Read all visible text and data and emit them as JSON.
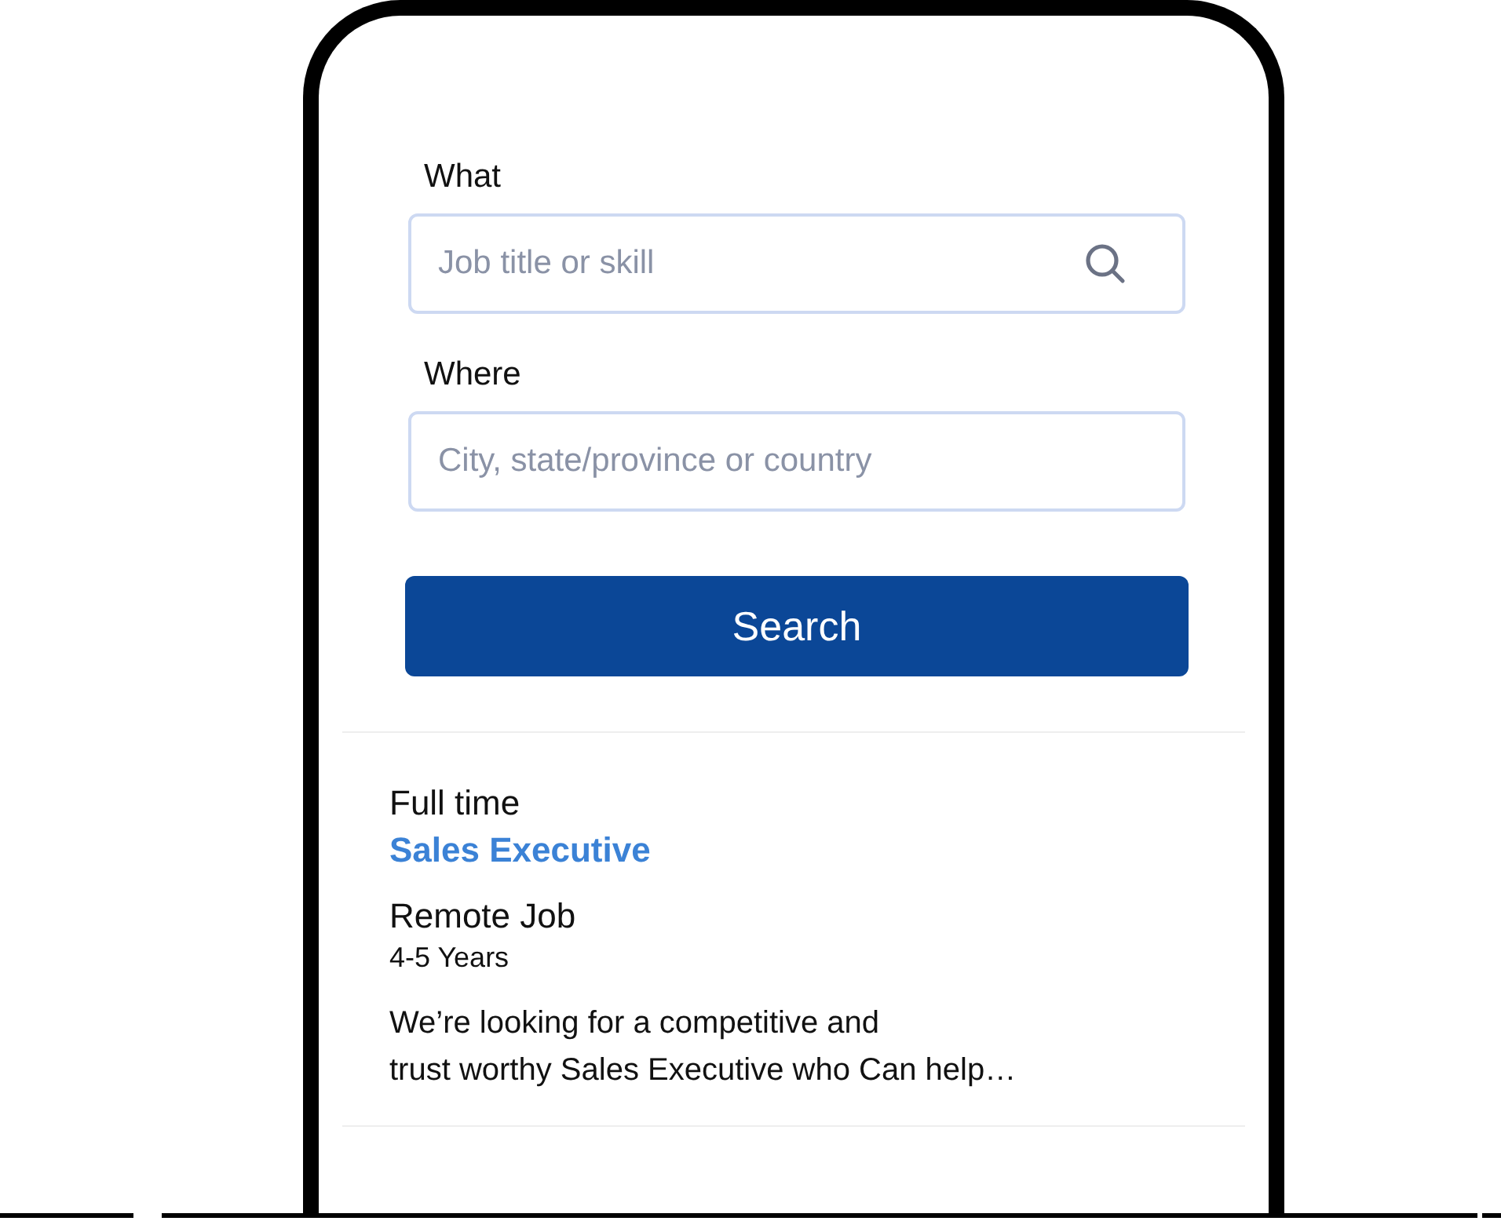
{
  "search_form": {
    "fields": [
      {
        "label": "What",
        "placeholder": "Job title or skill",
        "kind": "search"
      },
      {
        "label": "Where",
        "placeholder": "City, state/province or country",
        "kind": "plain"
      }
    ],
    "button": "Search"
  },
  "job_listing": {
    "job_type": "Full time",
    "title": "Sales Executive",
    "location": "Remote Job",
    "experience": "4-5 Years",
    "description": "We’re looking for a competitive and\ntrust worthy Sales Executive who Can help…"
  }
}
